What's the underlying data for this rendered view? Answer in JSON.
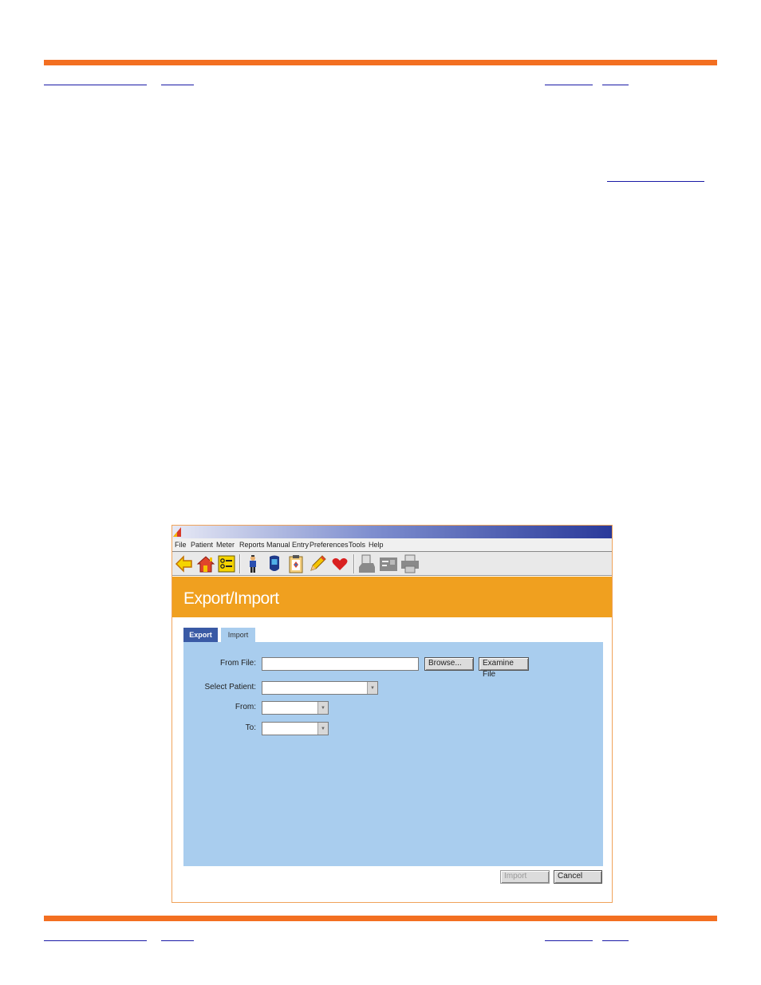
{
  "app": {
    "menu": [
      "File",
      "Patient",
      "Meter",
      "Reports",
      "Manual Entry",
      "Preferences",
      "Tools",
      "Help"
    ],
    "toolbar_icons": [
      "back-arrow-icon",
      "home-icon",
      "checklist-icon",
      "person-icon",
      "meter-icon",
      "clipboard-icon",
      "pencil-icon",
      "heart-icon",
      "printer-doc-icon",
      "export-printer-icon",
      "print-icon"
    ],
    "header_title": "Export/Import",
    "tabs": {
      "export": "Export",
      "import": "Import"
    },
    "form": {
      "from_file_label": "From File:",
      "from_file_value": "",
      "browse_label": "Browse...",
      "examine_label": "Examine File",
      "select_patient_label": "Select Patient:",
      "select_patient_value": "",
      "from_label": "From:",
      "from_value": "",
      "to_label": "To:",
      "to_value": ""
    },
    "footer": {
      "import_label": "Import",
      "cancel_label": "Cancel"
    }
  },
  "colors": {
    "accent_orange": "#f36f21",
    "header_orange": "#f0a01f",
    "panel_blue": "#a9cdee",
    "tab_blue": "#3a5aa5",
    "link_blue": "#1a1aa6"
  }
}
